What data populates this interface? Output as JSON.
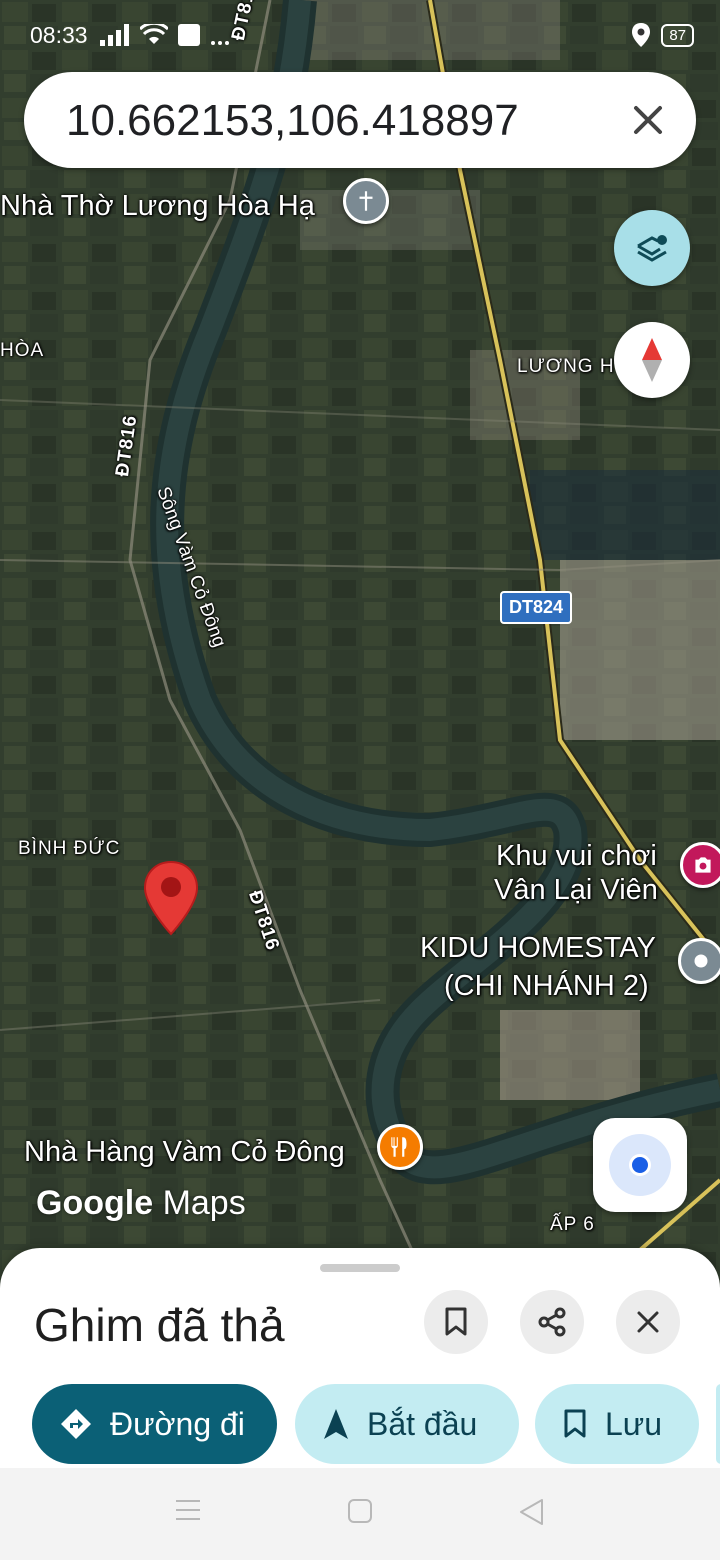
{
  "status_bar": {
    "time": "08:33",
    "battery": "87"
  },
  "search": {
    "query": "10.662153,106.418897"
  },
  "map": {
    "labels": {
      "church": "Nhà Thờ Lương Hòa Hạ",
      "hoa": "HÒA",
      "luong_h": "LƯƠNG H",
      "road_top": "ĐT816",
      "road_left": "ĐT816",
      "road_mid": "ĐT816",
      "river": "Sông Vàm Cỏ Đông",
      "route_824": "DT824",
      "binh_duc": "BÌNH ĐỨC",
      "park_1": "Khu vui chơi",
      "park_2": "Vân Lại Viên",
      "homestay_1": "KIDU HOMESTAY",
      "homestay_2": "(CHI NHÁNH 2)",
      "restaurant": "Nhà Hàng Vàm Cỏ Đông",
      "ap6": "ẤP 6"
    },
    "watermark": {
      "google": "Google",
      "maps": "Maps"
    }
  },
  "sheet": {
    "title": "Ghim đã thả",
    "actions": {
      "directions": "Đường đi",
      "start": "Bắt đầu",
      "save": "Lưu"
    }
  },
  "colors": {
    "primary_chip": "#0b6076",
    "secondary_chip": "#c3ecf2",
    "pin_red": "#e53935",
    "poi_orange": "#f57c00",
    "poi_pink": "#c2185b",
    "poi_gray": "#7b8a93"
  }
}
